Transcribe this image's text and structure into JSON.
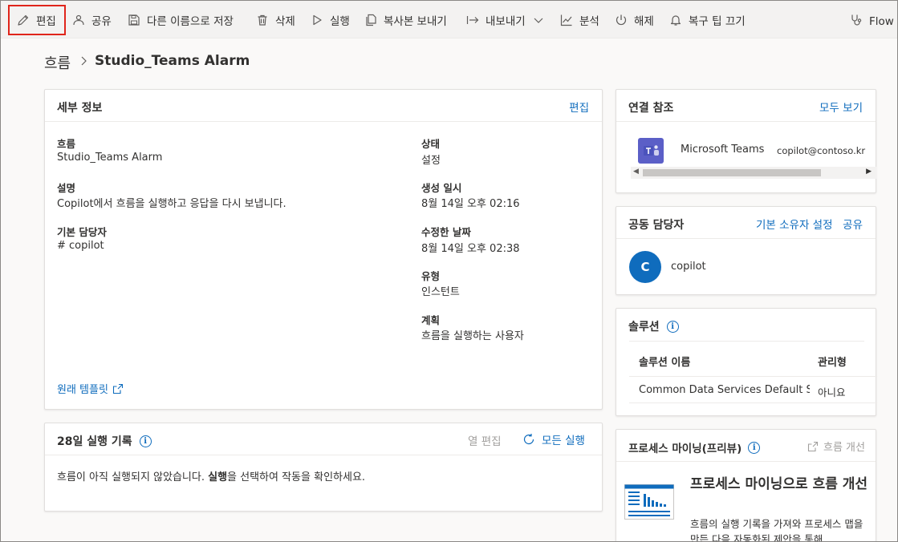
{
  "toolbar": {
    "edit": "편집",
    "share": "공유",
    "save_as": "다른 이름으로 저장",
    "delete": "삭제",
    "run": "실행",
    "send_copy": "복사본 보내기",
    "export": "내보내기",
    "analytics": "분석",
    "turn_off": "해제",
    "tips_off": "복구 팁 끄기",
    "flow_checker": "Flow 검사기"
  },
  "breadcrumb": {
    "root": "흐름",
    "current": "Studio_Teams Alarm"
  },
  "details": {
    "title": "세부 정보",
    "edit_link": "편집",
    "fields": {
      "flow_label": "흐름",
      "flow_value": "Studio_Teams Alarm",
      "desc_label": "설명",
      "desc_value": "Copilot에서 흐름을 실행하고 응답을 다시 보냅니다.",
      "owner_label": "기본 담당자",
      "owner_value": "# copilot",
      "status_label": "상태",
      "status_value": "설정",
      "created_label": "생성 일시",
      "created_value": "8월 14일 오후 02:16",
      "modified_label": "수정한 날짜",
      "modified_value": "8월 14일 오후 02:38",
      "type_label": "유형",
      "type_value": "인스턴트",
      "plan_label": "계획",
      "plan_value": "흐름을 실행하는 사용자"
    },
    "template_link": "원래 템플릿"
  },
  "history": {
    "title": "28일 실행 기록",
    "edit_columns": "열 편집",
    "all_runs": "모든 실행",
    "empty_prefix": "흐름이 아직 실행되지 않았습니다. ",
    "empty_bold": "실행",
    "empty_suffix": "을 선택하여 작동을 확인하세요."
  },
  "connections": {
    "title": "연결 참조",
    "see_all": "모두 보기",
    "items": [
      {
        "name": "Microsoft Teams Connection",
        "account": "copilot@contoso.kr"
      }
    ]
  },
  "coowners": {
    "title": "공동 담당자",
    "set_owner": "기본 소유자 설정",
    "share": "공유",
    "items": [
      {
        "initial": "C",
        "name": "copilot"
      }
    ]
  },
  "solutions": {
    "title": "솔루션",
    "col_name": "솔루션 이름",
    "col_managed": "관리형",
    "rows": [
      {
        "name": "Common Data Services Default Solution",
        "managed": "아니요"
      }
    ]
  },
  "process_mining": {
    "title": "프로세스 마이닝(프리뷰)",
    "improve": "흐름 개선",
    "headline": "프로세스 마이닝으로 흐름 개선",
    "body": "흐름의 실행 기록을 가져와 프로세스 맵을 만든 다음 자동화된 제안을 통해"
  },
  "colors": {
    "accent": "#0f6cbd",
    "highlight": "#e0251b",
    "teams": "#5b5fc7",
    "avatar": "#0f6cbd"
  }
}
